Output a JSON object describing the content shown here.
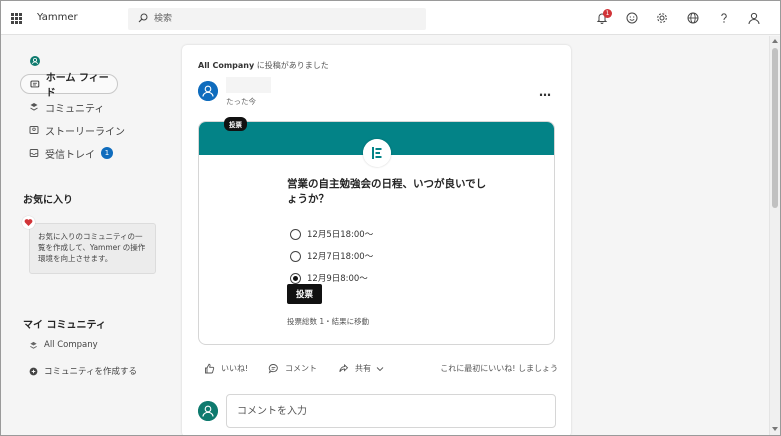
{
  "app": {
    "title": "Yammer"
  },
  "search": {
    "placeholder": "検索"
  },
  "header": {
    "notification_count": "1"
  },
  "sidebar": {
    "nav": [
      {
        "label": "ホーム フィード"
      },
      {
        "label": "コミュニティ"
      },
      {
        "label": "ストーリーライン"
      },
      {
        "label": "受信トレイ",
        "badge": "1"
      }
    ],
    "favorites": {
      "title": "お気に入り",
      "hint": "お気に入りのコミュニティの一覧を作成して、Yammer の操作環境を向上させます。"
    },
    "my_communities": {
      "title": "マイ コミュニティ",
      "items": [
        {
          "label": "All Company"
        },
        {
          "label": "コミュニティを作成する"
        }
      ]
    }
  },
  "post": {
    "community": "All Company",
    "posted_suffix": " に投稿がありました",
    "time": "たった今",
    "more": "…",
    "poll": {
      "chip": "投票",
      "question": "営業の自主勉強会の日程、いつが良いでしょうか？",
      "options": [
        {
          "label": "12月5日18:00～",
          "selected": false
        },
        {
          "label": "12月7日18:00～",
          "selected": false
        },
        {
          "label": "12月9日8:00～",
          "selected": true
        }
      ],
      "vote_label": "投票",
      "summary": "投票総数 1・結果に移動"
    },
    "actions": {
      "like": "いいね!",
      "comment": "コメント",
      "share": "共有",
      "first_like": "これに最初にいいね! しましょう"
    },
    "comment_placeholder": "コメントを入力"
  },
  "colors": {
    "poll_header": "#038387",
    "accent_blue": "#0f6cbd",
    "badge_red": "#d13438"
  }
}
